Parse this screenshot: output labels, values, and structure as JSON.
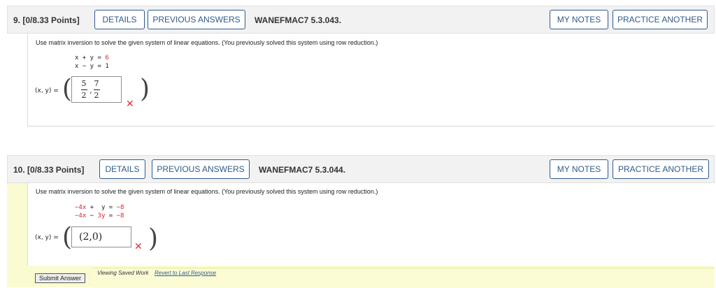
{
  "q9": {
    "number_label": "9.  [0/8.33 Points]",
    "details": "DETAILS",
    "previous_answers": "PREVIOUS ANSWERS",
    "code": "WANEFMAC7 5.3.043.",
    "my_notes": "MY NOTES",
    "practice_another": "PRACTICE ANOTHER",
    "instruction": "Use matrix inversion to solve the given system of linear equations. (You previously solved this system using row reduction.)",
    "eq1_lhs": "x + y = ",
    "eq1_rhs": "6",
    "eq2": "x − y = 1",
    "answer_label": "(x, y) =",
    "answer_num1": "5",
    "answer_den1": "2",
    "answer_num2": "7",
    "answer_den2": "2",
    "answer_sep": ",",
    "incorrect_mark": "✕"
  },
  "q10": {
    "number_label": "10.  [0/8.33 Points]",
    "details": "DETAILS",
    "previous_answers": "PREVIOUS ANSWERS",
    "code": "WANEFMAC7 5.3.044.",
    "my_notes": "MY NOTES",
    "practice_another": "PRACTICE ANOTHER",
    "instruction": "Use matrix inversion to solve the given system of linear equations. (You previously solved this system using row reduction.)",
    "eq1_a": "−4x",
    "eq1_b": " +  ",
    "eq1_c": "y",
    "eq1_d": " = ",
    "eq1_e": "−8",
    "eq2_a": "−4x",
    "eq2_b": " − ",
    "eq2_c": "3y",
    "eq2_d": " = ",
    "eq2_e": "−8",
    "answer_label": "(x, y) =",
    "answer_value": "(2,0)",
    "incorrect_mark": "✕",
    "submit_label": "Submit Answer",
    "viewing_text": "Viewing Saved Work",
    "revert_link": "Revert to Last Response"
  }
}
